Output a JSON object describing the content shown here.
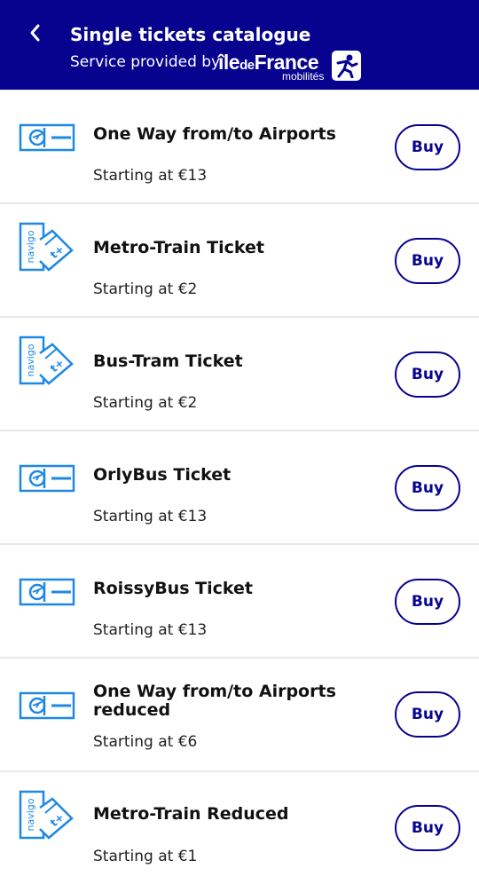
{
  "header": {
    "title": "Single tickets catalogue",
    "subtitle_prefix": "Service provided by",
    "brand_ile": "île",
    "brand_de": "de",
    "brand_france": "France",
    "brand_sub": "mobilités",
    "back_icon": "chevron-left-icon",
    "background": "#07038f"
  },
  "tickets": [
    {
      "name": "One Way from/to Airports",
      "price": "Starting at €13",
      "buy_label": "Buy",
      "icon": "airport-ticket-icon"
    },
    {
      "name": "Metro-Train Ticket",
      "price": "Starting at €2",
      "buy_label": "Buy",
      "icon": "navigo-ticket-icon"
    },
    {
      "name": "Bus-Tram Ticket",
      "price": "Starting at €2",
      "buy_label": "Buy",
      "icon": "navigo-ticket-icon"
    },
    {
      "name": "OrlyBus Ticket",
      "price": "Starting at €13",
      "buy_label": "Buy",
      "icon": "airport-ticket-icon"
    },
    {
      "name": "RoissyBus Ticket",
      "price": "Starting at €13",
      "buy_label": "Buy",
      "icon": "airport-ticket-icon"
    },
    {
      "name": "One Way from/to Airports reduced",
      "price": "Starting at €6",
      "buy_label": "Buy",
      "icon": "airport-ticket-icon"
    },
    {
      "name": "Metro-Train Reduced",
      "price": "Starting at €1",
      "buy_label": "Buy",
      "icon": "navigo-ticket-icon"
    }
  ],
  "colors": {
    "accent": "#07038f",
    "icon_blue": "#1e88e5"
  }
}
